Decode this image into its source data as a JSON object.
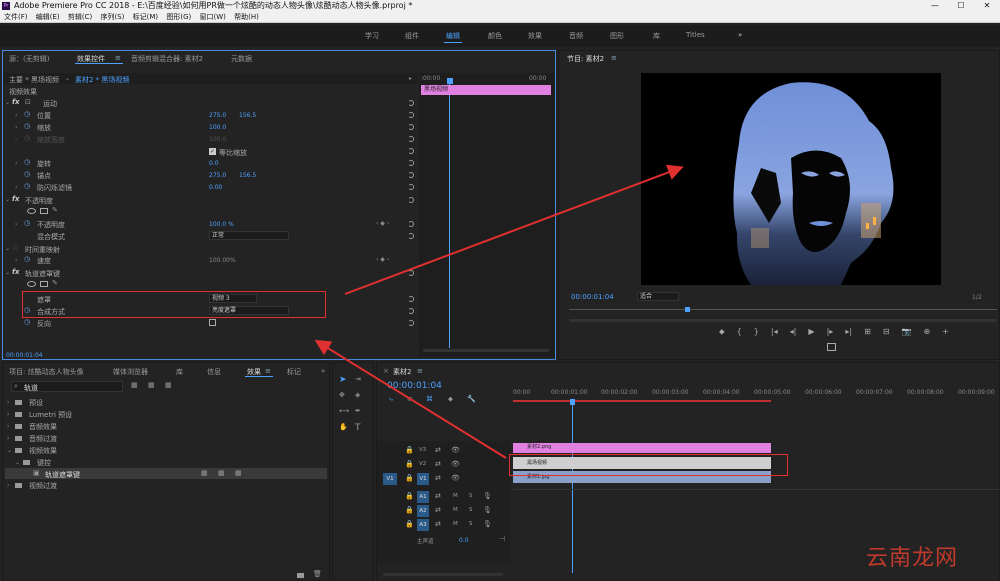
{
  "app": {
    "title": "Adobe Premiere Pro CC 2018 - E:\\百度经验\\如何用PR做一个炫酷的动态人物头像\\炫酷动态人物头像.prproj *",
    "logo": "Pr",
    "window_controls": [
      "—",
      "☐",
      "✕"
    ]
  },
  "menu": [
    "文件(F)",
    "编辑(E)",
    "剪辑(C)",
    "序列(S)",
    "标记(M)",
    "图形(G)",
    "窗口(W)",
    "帮助(H)"
  ],
  "workspaces": {
    "items": [
      "学习",
      "组件",
      "编辑",
      "颜色",
      "效果",
      "音频",
      "图形",
      "库",
      "Titles"
    ],
    "active": "编辑",
    "more": "»"
  },
  "effect_controls": {
    "tabs": [
      "源：(无剪辑)",
      "效果控件",
      "音频剪辑混合器: 素材2",
      "元数据"
    ],
    "menu_icon": "≡",
    "source_label": "主要 * 黑场视频",
    "clip_label": "素材2 * 黑场视频",
    "section": "视频效果",
    "mini_timeline": {
      "start": ":00:00",
      "end": "00:00",
      "clip": "黑场视频"
    },
    "motion": {
      "title": "运动",
      "position": {
        "label": "位置",
        "x": "275.0",
        "y": "156.5"
      },
      "scale": {
        "label": "缩放",
        "value": "100.0"
      },
      "scale_width": {
        "label": "缩放宽度",
        "value": "100.0"
      },
      "uniform_scale": "等比缩放",
      "rotation": {
        "label": "旋转",
        "value": "0.0"
      },
      "anchor": {
        "label": "锚点",
        "x": "275.0",
        "y": "156.5"
      },
      "antiflicker": {
        "label": "防闪烁滤镜",
        "value": "0.00"
      }
    },
    "opacity": {
      "title": "不透明度",
      "opacity": {
        "label": "不透明度",
        "value": "100.0 %"
      },
      "blend": {
        "label": "混合模式",
        "value": "正常"
      }
    },
    "time_remap": {
      "title": "时间重映射",
      "speed": {
        "label": "速度",
        "value": "100.00%"
      }
    },
    "track_matte": {
      "title": "轨道遮罩键",
      "matte": {
        "label": "遮罩",
        "value": "视频 3"
      },
      "composite": {
        "label": "合成方式",
        "value": "亮度遮罩"
      },
      "reverse": {
        "label": "反向"
      }
    },
    "timecode": "00:00:01:04"
  },
  "program_monitor": {
    "title": "节目: 素材2",
    "menu_icon": "≡",
    "timecode": "00:00:01:04",
    "fit": "适合",
    "quality": "1/2",
    "controls": [
      "⬥",
      "{",
      "}",
      "|◂",
      "◂|",
      "▶",
      "|▸",
      "▸|",
      "⊞",
      "⊟",
      "📷",
      "⊕",
      "+"
    ]
  },
  "project_panel": {
    "tabs": [
      "项目: 炫酷动态人物头像",
      "媒体浏览器",
      "库",
      "信息",
      "效果",
      "标记"
    ],
    "active_tab": "效果",
    "search_value": "轨道",
    "tree": [
      {
        "label": "预设",
        "indent": 0
      },
      {
        "label": "Lumetri 预设",
        "indent": 0
      },
      {
        "label": "音频效果",
        "indent": 0
      },
      {
        "label": "音频过渡",
        "indent": 0
      },
      {
        "label": "视频效果",
        "indent": 0
      },
      {
        "label": "键控",
        "indent": 1
      },
      {
        "label": "轨道遮罩键",
        "indent": 2
      },
      {
        "label": "视频过渡",
        "indent": 0
      }
    ]
  },
  "timeline": {
    "title": "素材2",
    "menu_icon": "≡",
    "timecode": "00:00:01:04",
    "ruler": [
      "00:00",
      "00:00:01:00",
      "00:00:02:00",
      "00:00:03:00",
      "00:00:04:00",
      "00:00:05:00",
      "00:00:06:00",
      "00:00:07:00",
      "00:00:08:00",
      "00:00:09:00"
    ],
    "video_tracks": [
      "V3",
      "V2",
      "V1"
    ],
    "audio_tracks": [
      "A1",
      "A2",
      "A3"
    ],
    "source_patch": "V1",
    "master": {
      "label": "主声道",
      "value": "0.0"
    },
    "track_buttons": [
      "M",
      "S"
    ],
    "clips": [
      {
        "track": "V3",
        "label": "素材2.png",
        "color": "#e080e0"
      },
      {
        "track": "V2",
        "label": "黑场视频",
        "color": "#cfcfcf"
      },
      {
        "track": "V1",
        "label": "素材1.jpg",
        "color": "#8aa0c8"
      }
    ]
  },
  "watermark": "云南龙网",
  "colors": {
    "accent": "#4ea1ff",
    "annotation": "#e03030",
    "clip_pink": "#e080e0"
  }
}
